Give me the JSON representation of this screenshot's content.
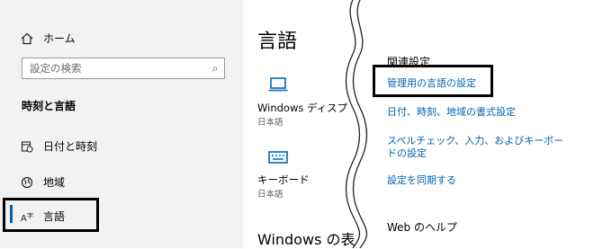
{
  "sidebar": {
    "home_label": "ホーム",
    "search_placeholder": "設定の検索",
    "category": "時刻と言語",
    "items": [
      {
        "label": "日付と時刻",
        "icon": "calendar-clock-icon"
      },
      {
        "label": "地域",
        "icon": "globe-icon"
      },
      {
        "label": "言語",
        "icon": "language-icon",
        "active": true
      }
    ]
  },
  "main": {
    "title": "言語",
    "tiles": [
      {
        "label": "Windows ディスプ",
        "sub": "日本語",
        "icon": "laptop-icon"
      },
      {
        "label": "キーボード",
        "sub": "日本語",
        "icon": "keyboard-icon"
      }
    ],
    "section_title": "Windows の表"
  },
  "related": {
    "heading": "関連設定",
    "links": [
      "管理用の言語の設定",
      "日付、時刻、地域の書式設定",
      "スペルチェック、入力、およびキーボードの設定",
      "設定を同期する"
    ],
    "help": "Web のヘルプ"
  },
  "colors": {
    "accent": "#0063b1",
    "sidebar_bg": "#f2f2f2"
  }
}
